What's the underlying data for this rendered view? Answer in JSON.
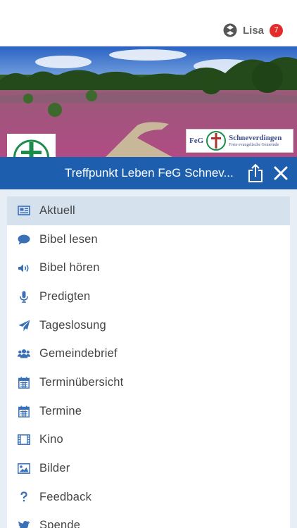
{
  "header": {
    "user_name": "Lisa",
    "notification_count": "7"
  },
  "logos": {
    "right_prefix": "FeG",
    "right_name": "Schneverdingen",
    "right_subtitle": "Freie evangelische Gemeinde"
  },
  "titlebar": {
    "title": "Treffpunkt Leben FeG Schnev..."
  },
  "colors": {
    "accent": "#1d5fae",
    "icon": "#3a70b8",
    "badge": "#e32b2b",
    "active_row": "#d6e1ee"
  },
  "menu": {
    "items": [
      {
        "label": "Aktuell",
        "icon": "newspaper-icon"
      },
      {
        "label": "Bibel lesen",
        "icon": "speech-bubble-icon"
      },
      {
        "label": "Bibel hören",
        "icon": "volume-icon"
      },
      {
        "label": "Predigten",
        "icon": "microphone-icon"
      },
      {
        "label": "Tageslosung",
        "icon": "paper-plane-icon"
      },
      {
        "label": "Gemeindebrief",
        "icon": "users-icon"
      },
      {
        "label": "Terminübersicht",
        "icon": "calendar-icon"
      },
      {
        "label": "Termine",
        "icon": "calendar-icon"
      },
      {
        "label": "Kino",
        "icon": "film-icon"
      },
      {
        "label": "Bilder",
        "icon": "image-icon"
      },
      {
        "label": "Feedback",
        "icon": "question-icon"
      },
      {
        "label": "Spende",
        "icon": "bird-icon"
      }
    ]
  }
}
